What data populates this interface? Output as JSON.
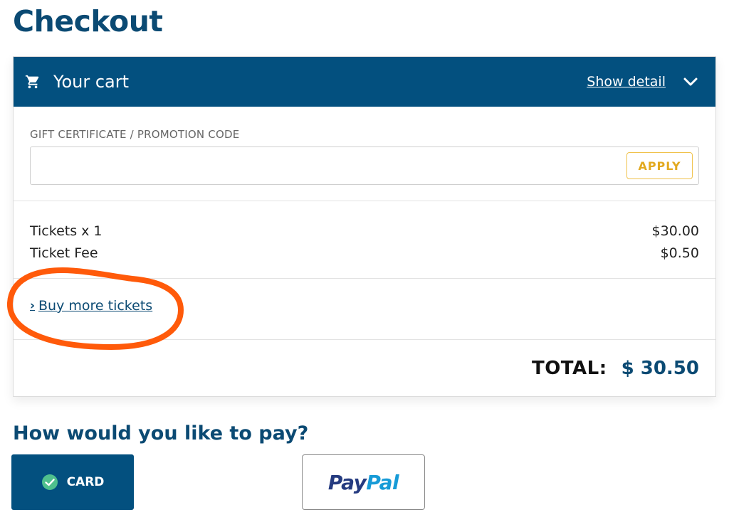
{
  "page": {
    "title": "Checkout"
  },
  "cart": {
    "title": "Your cart",
    "show_detail_label": "Show detail",
    "promo": {
      "label": "GIFT CERTIFICATE / PROMOTION CODE",
      "value": "",
      "placeholder": "",
      "apply_label": "APPLY"
    },
    "items": [
      {
        "name": "Tickets x 1",
        "price": "$30.00"
      },
      {
        "name": "Ticket Fee",
        "price": "$0.50"
      }
    ],
    "buy_more_label": "Buy more tickets",
    "total_label": "TOTAL:",
    "total_value": "$ 30.50"
  },
  "payment": {
    "heading": "How would you like to pay?",
    "options": [
      {
        "label": "CARD",
        "selected": true
      },
      {
        "label_part1": "Pay",
        "label_part2": "Pal",
        "selected": false
      }
    ]
  },
  "colors": {
    "brand": "#03507f",
    "apply_accent": "#e2a91f",
    "annotation": "#ff5a0a",
    "paypal_dark": "#253b80",
    "paypal_light": "#179bd7"
  },
  "icons": {
    "cart": "shopping-cart-icon",
    "chevron": "chevron-down-icon",
    "buy_more_chevron": "chevron-right-icon",
    "card_check": "check-circle-icon"
  }
}
